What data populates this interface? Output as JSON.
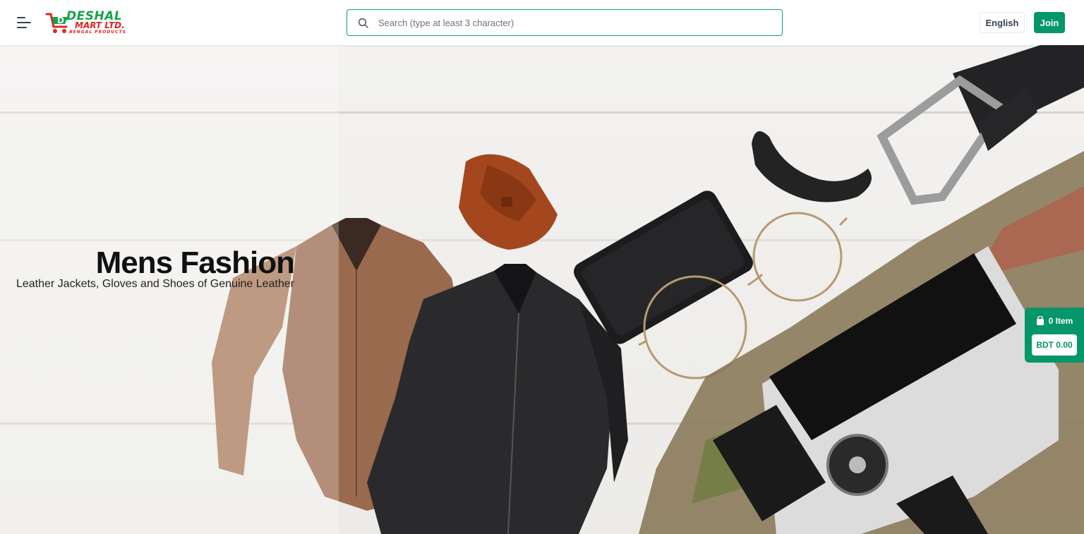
{
  "header": {
    "logo": {
      "name": "DESHAL",
      "line2": "MART LTD.",
      "tagline": "BENGAL PRODUCTS"
    },
    "search": {
      "placeholder": "Search (type at least 3 character)"
    },
    "language_label": "English",
    "join_label": "Join"
  },
  "hero": {
    "title": "Mens Fashion",
    "subtitle": "Leather Jackets, Gloves and Shoes of Genuine Leather"
  },
  "cart": {
    "items_label": "0 Item",
    "total_label": "BDT 0.00"
  },
  "colors": {
    "accent": "#059669",
    "logo_green": "#16a34a",
    "logo_red": "#dc2626"
  }
}
